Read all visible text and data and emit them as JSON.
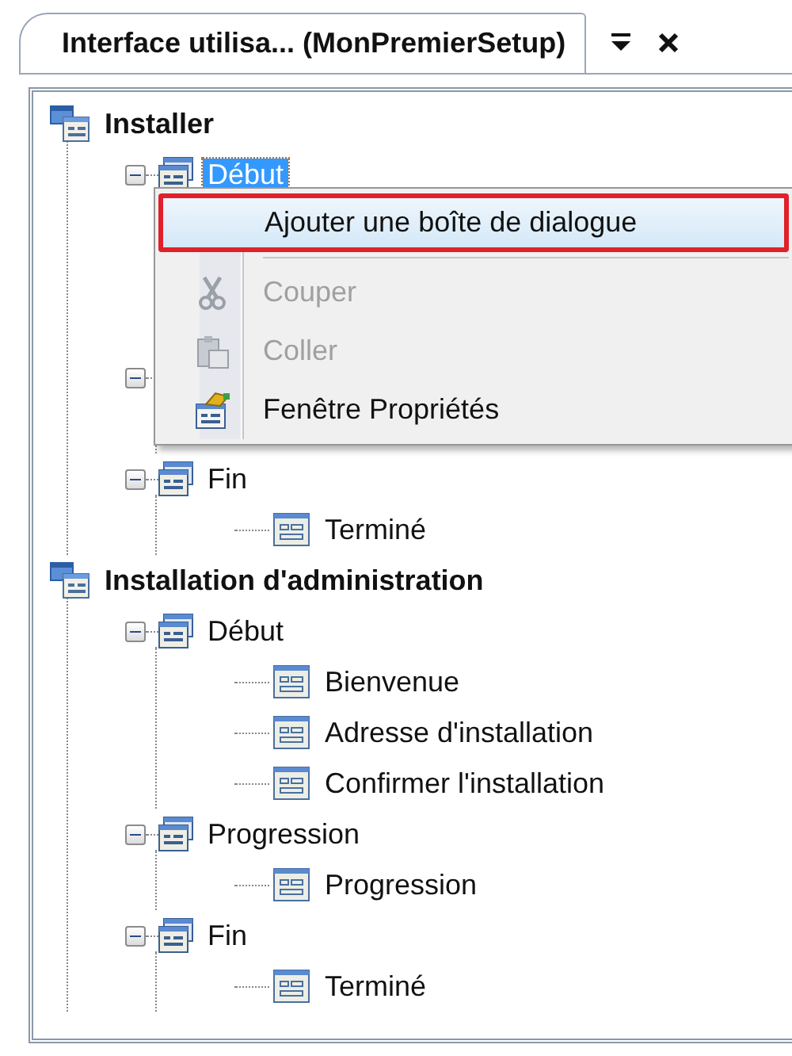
{
  "tab": {
    "label": "Interface utilisa... (MonPremierSetup)",
    "selected": true
  },
  "tree": [
    {
      "label": "Installer",
      "kind": "root",
      "children": [
        {
          "label": "Début",
          "kind": "group",
          "selected": true,
          "expanded": true,
          "children": [
            {
              "kind": "page"
            },
            {
              "kind": "page"
            },
            {
              "kind": "page"
            }
          ]
        },
        {
          "kind": "group",
          "expanded": true,
          "children": [
            {
              "kind": "page"
            }
          ]
        },
        {
          "label": "Fin",
          "kind": "group",
          "selected": false,
          "expanded": true,
          "children": [
            {
              "label": "Terminé",
              "kind": "page"
            }
          ]
        }
      ]
    },
    {
      "label": "Installation d'administration",
      "kind": "root",
      "children": [
        {
          "label": "Début",
          "kind": "group",
          "selected": false,
          "expanded": true,
          "children": [
            {
              "label": "Bienvenue",
              "kind": "page"
            },
            {
              "label": "Adresse d'installation",
              "kind": "page"
            },
            {
              "label": "Confirmer l'installation",
              "kind": "page"
            }
          ]
        },
        {
          "label": "Progression",
          "kind": "group",
          "selected": false,
          "expanded": true,
          "children": [
            {
              "label": "Progression",
              "kind": "page"
            }
          ]
        },
        {
          "label": "Fin",
          "kind": "group",
          "selected": false,
          "expanded": true,
          "children": [
            {
              "label": "Terminé",
              "kind": "page"
            }
          ]
        }
      ]
    }
  ],
  "context_menu": [
    {
      "kind": "item",
      "label": "Ajouter une boîte de dialogue",
      "selected": true,
      "disabled": false
    },
    {
      "kind": "separator"
    },
    {
      "kind": "item",
      "label": "Couper",
      "selected": false,
      "disabled": true
    },
    {
      "kind": "item",
      "label": "Coller",
      "selected": false,
      "disabled": true
    },
    {
      "kind": "item",
      "label": "Fenêtre Propriétés",
      "selected": false,
      "disabled": false
    }
  ]
}
